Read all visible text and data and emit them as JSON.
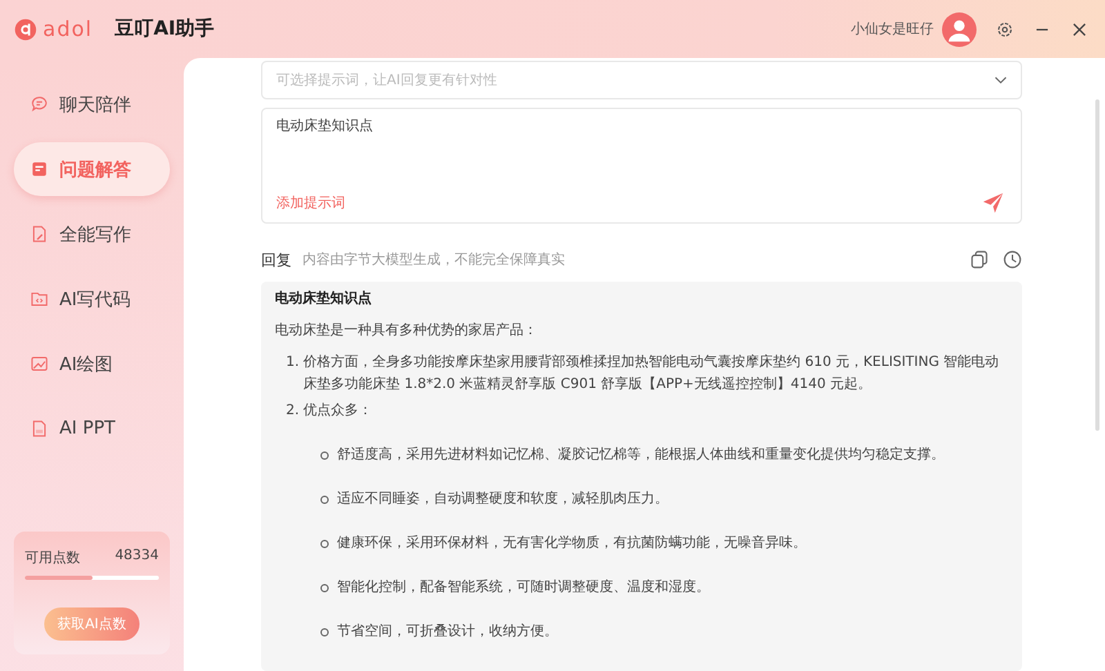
{
  "app": {
    "logo_text": "adol",
    "title": "豆叮AI助手"
  },
  "user": {
    "name": "小仙女是旺仔"
  },
  "sidebar": {
    "items": [
      {
        "label": "聊天陪伴",
        "kind": "chat",
        "selected": false
      },
      {
        "label": "问题解答",
        "kind": "qa",
        "selected": true
      },
      {
        "label": "全能写作",
        "kind": "write",
        "selected": false
      },
      {
        "label": "AI写代码",
        "kind": "code",
        "selected": false
      },
      {
        "label": "AI绘图",
        "kind": "draw",
        "selected": false
      },
      {
        "label": "AI PPT",
        "kind": "ppt",
        "selected": false
      }
    ],
    "points": {
      "label": "可用点数",
      "value": "48334",
      "level": 0.5,
      "button": "获取AI点数"
    }
  },
  "prompt_select": {
    "placeholder": "可选择提示词，让AI回复更有针对性"
  },
  "question": {
    "value": "电动床垫知识点",
    "add_prompt": "添加提示词"
  },
  "reply": {
    "title": "回复",
    "note": "内容由字节大模型生成，不能完全保障真实",
    "heading": "电动床垫知识点",
    "intro": "电动床垫是一种具有多种优势的家居产品：",
    "items": [
      {
        "marker": "1.",
        "text": "价格方面，全身多功能按摩床垫家用腰背部颈椎揉捏加热智能电动气囊按摩床垫约 610 元，KELISITING 智能电动床垫多功能床垫 1.8*2.0 米蓝精灵舒享版 C901 舒享版【APP+无线遥控控制】4140 元起。"
      },
      {
        "marker": "2.",
        "text": "优点众多：",
        "bullets": [
          "舒适度高，采用先进材料如记忆棉、凝胶记忆棉等，能根据人体曲线和重量变化提供均匀稳定支撑。",
          "适应不同睡姿，自动调整硬度和软度，减轻肌肉压力。",
          "健康环保，采用环保材料，无有害化学物质，有抗菌防螨功能，无噪音异味。",
          "智能化控制，配备智能系统，可随时调整硬度、温度和湿度。",
          "节省空间，可折叠设计，收纳方便。"
        ]
      }
    ]
  }
}
